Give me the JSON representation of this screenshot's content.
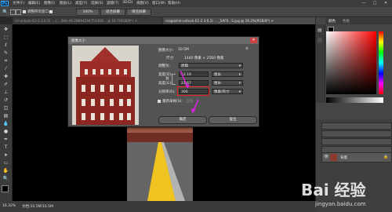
{
  "app": {
    "logo": "Ps",
    "minimize": "—",
    "maximize": "□",
    "close": "✕"
  },
  "menu": [
    "文件(F)",
    "编辑(E)",
    "图像(I)",
    "图层(L)",
    "类型(Y)",
    "选择(S)",
    "滤镜(T)",
    "3D(D)",
    "视图(V)",
    "窗口(W)",
    "帮助(H)"
  ],
  "options": {
    "checkbox_label": "调整所有窗口",
    "zoom": "100%",
    "fit_screen": "适合屏幕",
    "fill_screen": "填充屏幕"
  },
  "tabs": [
    {
      "label": "ce-untuck-E1-2.3.0.3) ... (... 6Hz-49-28894294751466... @ 16.7(RGB/8*) ✕"
    },
    {
      "label": "magazine-untuck-E1-2.3.0.3) ... _5AF0...S.jpg @ 16.2%(RGB/8*) ✕"
    }
  ],
  "dialog": {
    "title": "图像大小",
    "size_label": "图像大小:",
    "size_value": "10.5M",
    "dimension_label": "尺寸:",
    "dimension_value": "1440 像素 × 2560 像素",
    "fit_label": "调整为:",
    "fit_value": "原稿",
    "width_label": "宽度(D):",
    "width_value": "12.19",
    "width_unit": "厘米",
    "height_label": "高度(G):",
    "height_value": "21.67",
    "height_unit": "厘米",
    "resolution_label": "分辨率(R):",
    "resolution_value": "300",
    "resolution_unit": "像素/英寸",
    "resample_label": "重新采样(S):",
    "resample_value": "自动",
    "ok_label": "确定",
    "cancel_label": "复位"
  },
  "panels": {
    "color_tabs": [
      "颜色",
      "色板"
    ],
    "layer_name": "背景"
  },
  "status": {
    "zoom": "16.32%",
    "doc": "文档:10.5M/10.5M"
  },
  "watermark": {
    "brand": "Bai 经验",
    "url": "jingyan.baidu.com"
  },
  "colors": {
    "highlight_red": "#e8201c",
    "arrow_magenta": "#e020e0",
    "accent_blue": "#31a8ff"
  }
}
